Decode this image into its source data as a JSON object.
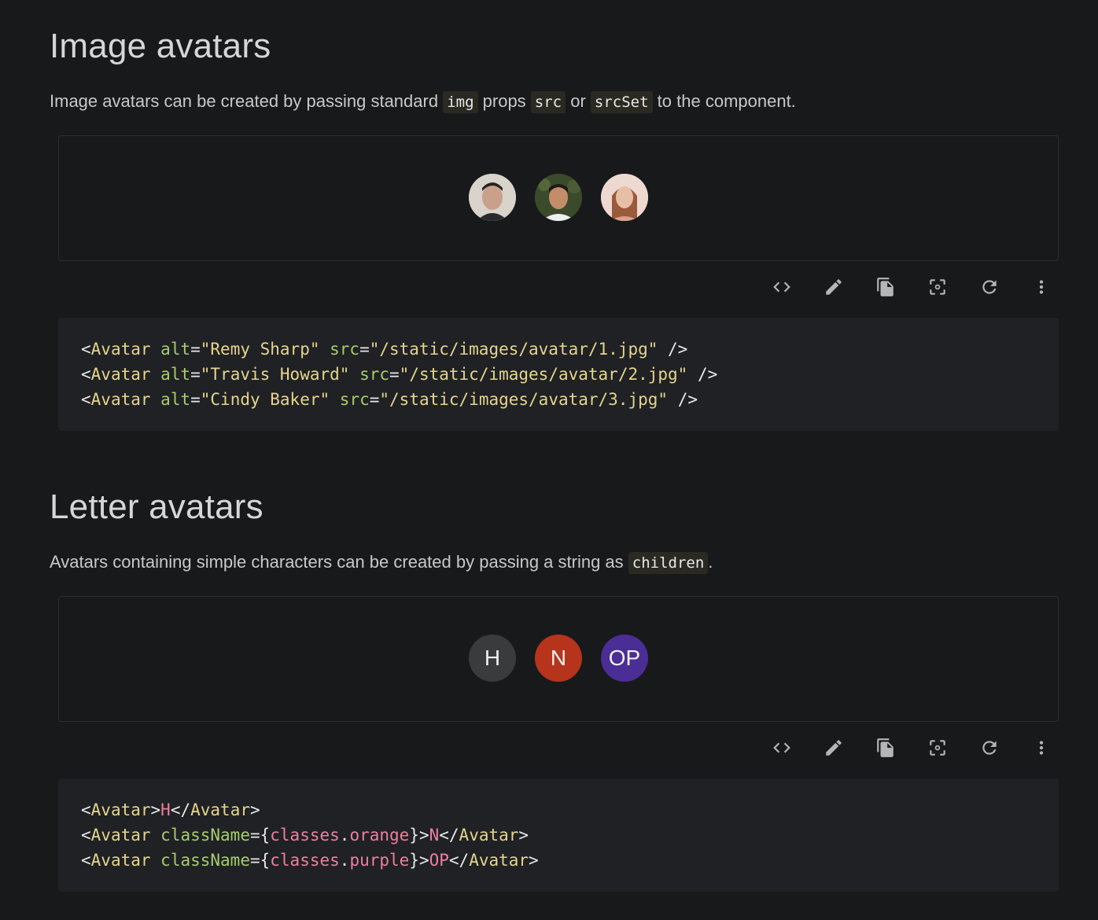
{
  "sections": [
    {
      "title": "Image avatars",
      "description": {
        "t1": "Image avatars can be created by passing standard ",
        "c1": "img",
        "t2": " props ",
        "c2": "src",
        "t3": " or ",
        "c3": "srcSet",
        "t4": " to the component."
      },
      "avatars": [
        {
          "alt": "Remy Sharp",
          "bg": "#d9d4cc"
        },
        {
          "alt": "Travis Howard",
          "bg": "#3a4a2c"
        },
        {
          "alt": "Cindy Baker",
          "bg": "#e9d6cf"
        }
      ],
      "code_lines": [
        {
          "attr1": "alt",
          "val1": "\"Remy Sharp\"",
          "attr2": "src",
          "val2": "\"/static/images/avatar/1.jpg\""
        },
        {
          "attr1": "alt",
          "val1": "\"Travis Howard\"",
          "attr2": "src",
          "val2": "\"/static/images/avatar/2.jpg\""
        },
        {
          "attr1": "alt",
          "val1": "\"Cindy Baker\"",
          "attr2": "src",
          "val2": "\"/static/images/avatar/3.jpg\""
        }
      ]
    },
    {
      "title": "Letter avatars",
      "description": {
        "t1": "Avatars containing simple characters can be created by passing a string as ",
        "c1": "children",
        "t2": "."
      },
      "avatars": [
        {
          "letter": "H",
          "bg": "#3a3b3d"
        },
        {
          "letter": "N",
          "bg": "#b5341b"
        },
        {
          "letter": "OP",
          "bg": "#4a2d95"
        }
      ],
      "code": {
        "line1": {
          "open": "<Avatar>",
          "content": "H",
          "close": "</Avatar>"
        },
        "line2": {
          "open": "<Avatar ",
          "attr": "className",
          "eq": "={",
          "obj": "classes",
          "dot": ".",
          "prop": "orange",
          "end": "}>",
          "content": "N",
          "close": "</Avatar>"
        },
        "line3": {
          "open": "<Avatar ",
          "attr": "className",
          "eq": "={",
          "obj": "classes",
          "dot": ".",
          "prop": "purple",
          "end": "}>",
          "content": "OP",
          "close": "</Avatar>"
        }
      }
    }
  ],
  "code_tag": {
    "open": "<Avatar",
    "selfclose": " />"
  },
  "toolbar_icons": [
    "code-icon",
    "edit-icon",
    "copy-icon",
    "focus-icon",
    "refresh-icon",
    "more-vert-icon"
  ]
}
